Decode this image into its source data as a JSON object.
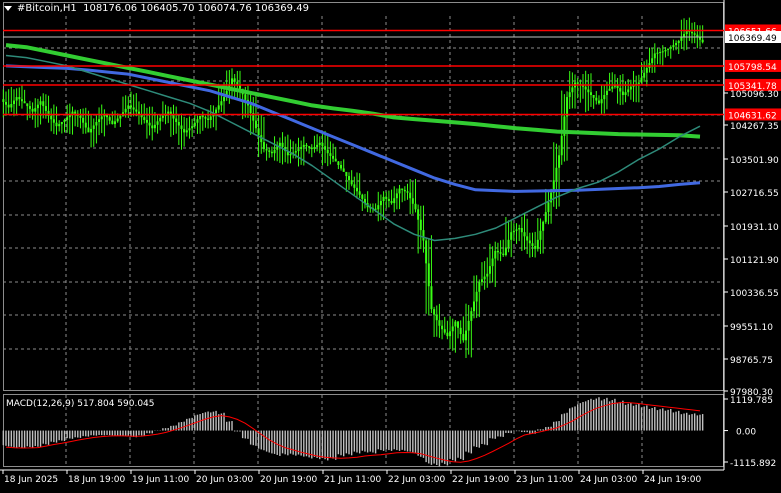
{
  "header": {
    "symbol": "#Bitcoin,H1",
    "ohlc": "108176.06 106405.70 106074.76 106369.49"
  },
  "colors": {
    "background": "#000000",
    "grid": "#8c8c8c",
    "candle": "#39ff14",
    "level_line": "#ff0000",
    "ma_fast": "#2e8b7a",
    "ma_mid": "#4169e1",
    "ma_slow": "#32cd32",
    "macd_hist": "#c0c0c0",
    "macd_signal": "#ff0000"
  },
  "chart_data": [
    {
      "type": "candlestick",
      "title": "",
      "ylim": [
        97980.3,
        107000
      ],
      "y_ticks": [
        "106369.49",
        "105798.54",
        "105341.78",
        "105096.30",
        "104631.62",
        "104267.35",
        "103501.90",
        "102716.55",
        "101931.10",
        "101121.90",
        "100336.55",
        "99551.10",
        "98765.75",
        "97980.30"
      ],
      "x_ticks": [
        "18 Jun 2025",
        "18 Jun 19:00",
        "19 Jun 11:00",
        "20 Jun 03:00",
        "20 Jun 19:00",
        "21 Jun 11:00",
        "22 Jun 03:00",
        "22 Jun 19:00",
        "23 Jun 11:00",
        "24 Jun 03:00",
        "24 Jun 19:00"
      ],
      "price_levels": [
        {
          "value": 106651.66,
          "label": "106651.66"
        },
        {
          "value": 105798.54,
          "label": "105798.54"
        },
        {
          "value": 105341.78,
          "label": "105341.78"
        },
        {
          "value": 104631.62,
          "label": "104631.62"
        }
      ],
      "current_price": {
        "value": 106369.49,
        "label": "106369.49"
      },
      "close_series": [
        104800,
        105050,
        104900,
        104700,
        104950,
        104600,
        104350,
        104500,
        104700,
        104550,
        104200,
        104450,
        104650,
        104400,
        104600,
        104850,
        104700,
        104500,
        104300,
        104550,
        104700,
        104450,
        104200,
        104350,
        104600,
        104500,
        104750,
        105050,
        105500,
        105250,
        104850,
        104300,
        103800,
        103700,
        103950,
        103650,
        103750,
        103900,
        103800,
        103950,
        103700,
        103500,
        103250,
        102950,
        102700,
        102400,
        102350,
        102650,
        102500,
        102850,
        102750,
        102350,
        101600,
        99950,
        99550,
        99300,
        99650,
        99200,
        99900,
        100600,
        100800,
        101350,
        101250,
        101800,
        101900,
        101600,
        101400,
        102050,
        102750,
        103650,
        105050,
        105400,
        105300,
        105100,
        104900,
        105200,
        105350,
        105100,
        105300,
        105400,
        105750,
        106100,
        106150,
        106250,
        106400,
        106650,
        106550,
        106369
      ],
      "moving_averages": [
        {
          "name": "",
          "color": "#32cd32",
          "values": [
            106300,
            106250,
            106150,
            106050,
            105950,
            105850,
            105750,
            105650,
            105550,
            105450,
            105350,
            105250,
            105150,
            105050,
            104950,
            104850,
            104780,
            104720,
            104650,
            104560,
            104520,
            104480,
            104440,
            104400,
            104350,
            104300,
            104260,
            104220,
            104200,
            104180,
            104160,
            104150,
            104140,
            104130,
            104100
          ]
        },
        {
          "name": "",
          "color": "#4169e1",
          "values": [
            105800,
            105780,
            105760,
            105740,
            105700,
            105650,
            105600,
            105500,
            105400,
            105300,
            105200,
            105050,
            104900,
            104700,
            104500,
            104300,
            104100,
            103900,
            103700,
            103500,
            103300,
            103100,
            102950,
            102820,
            102800,
            102780,
            102790,
            102800,
            102810,
            102830,
            102850,
            102870,
            102900,
            102950,
            102990
          ]
        },
        {
          "name": "",
          "color": "#2e8b7a",
          "values": [
            106050,
            106000,
            105900,
            105800,
            105650,
            105500,
            105350,
            105200,
            105050,
            104900,
            104700,
            104450,
            104200,
            103950,
            103700,
            103400,
            103050,
            102700,
            102350,
            102000,
            101750,
            101600,
            101650,
            101750,
            101900,
            102150,
            102400,
            102650,
            102850,
            103000,
            103250,
            103550,
            103800,
            104100,
            104350
          ]
        }
      ]
    },
    {
      "type": "bar",
      "title": "MACD(12,26,9) 517.804 590.045",
      "ylim": [
        -1115.892,
        1119.785
      ],
      "y_ticks": [
        "1119.785",
        "0.00",
        "-1115.892"
      ],
      "histogram": [
        -500,
        -550,
        -560,
        -540,
        -530,
        -450,
        -380,
        -330,
        -260,
        -230,
        -190,
        -160,
        -150,
        -150,
        -170,
        -180,
        -210,
        -160,
        -90,
        -10,
        80,
        160,
        280,
        400,
        520,
        600,
        620,
        560,
        300,
        -30,
        -260,
        -480,
        -620,
        -720,
        -800,
        -780,
        -790,
        -820,
        -880,
        -900,
        -940,
        -920,
        -810,
        -780,
        -720,
        -690,
        -720,
        -640,
        -640,
        -640,
        -660,
        -720,
        -860,
        -1080,
        -1130,
        -1100,
        -970,
        -930,
        -720,
        -540,
        -460,
        -260,
        -200,
        -80,
        -20,
        -50,
        -100,
        40,
        120,
        300,
        560,
        760,
        900,
        1000,
        1050,
        1030,
        1000,
        940,
        880,
        850,
        790,
        740,
        700,
        680,
        620,
        560,
        540,
        520
      ],
      "signal": [
        -520,
        -540,
        -550,
        -545,
        -535,
        -490,
        -440,
        -400,
        -350,
        -300,
        -260,
        -220,
        -190,
        -170,
        -165,
        -170,
        -180,
        -175,
        -150,
        -110,
        -60,
        10,
        90,
        180,
        270,
        360,
        430,
        470,
        430,
        350,
        230,
        60,
        -120,
        -290,
        -430,
        -540,
        -610,
        -680,
        -740,
        -800,
        -840,
        -860,
        -870,
        -860,
        -840,
        -800,
        -780,
        -760,
        -730,
        -700,
        -690,
        -700,
        -730,
        -800,
        -870,
        -930,
        -980,
        -1000,
        -960,
        -880,
        -780,
        -660,
        -530,
        -400,
        -260,
        -140,
        -90,
        -40,
        20,
        80,
        180,
        300,
        450,
        580,
        700,
        780,
        850,
        880,
        880,
        860,
        830,
        800,
        770,
        740,
        710,
        680,
        650,
        620
      ]
    }
  ]
}
